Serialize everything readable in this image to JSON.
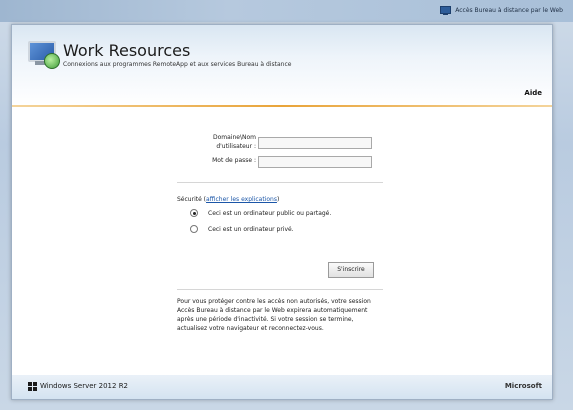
{
  "topbar": {
    "remote_link": "Accès Bureau à distance par le Web",
    "icon": "remote-desktop-icon"
  },
  "header": {
    "logo": "work-resources-icon",
    "title": "Work Resources",
    "subtitle": "Connexions aux programmes RemoteApp et aux services Bureau à distance",
    "help": "Aide"
  },
  "form": {
    "username_label_line1": "Domaine\\Nom",
    "username_label_line2": "d'utilisateur :",
    "username_value": "",
    "password_label": "Mot de passe :",
    "password_value": "",
    "security_label": "Sécurité (",
    "security_link": "afficher les explications",
    "security_close": ")",
    "radio_public": "Ceci est un ordinateur public ou partagé.",
    "radio_private": "Ceci est un ordinateur privé.",
    "radio_selected": "public",
    "signin_button": "S'inscrire",
    "note": "Pour vous protéger contre les accès non autorisés, votre session Accès Bureau à distance par le Web expirera automatiquement après une période d'inactivité. Si votre session se termine, actualisez votre navigateur et reconnectez-vous."
  },
  "footer": {
    "product": "Windows Server 2012 R2",
    "vendor": "Microsoft"
  },
  "colors": {
    "accent_orange": "#e9a43a",
    "link_blue": "#1b56a8"
  }
}
